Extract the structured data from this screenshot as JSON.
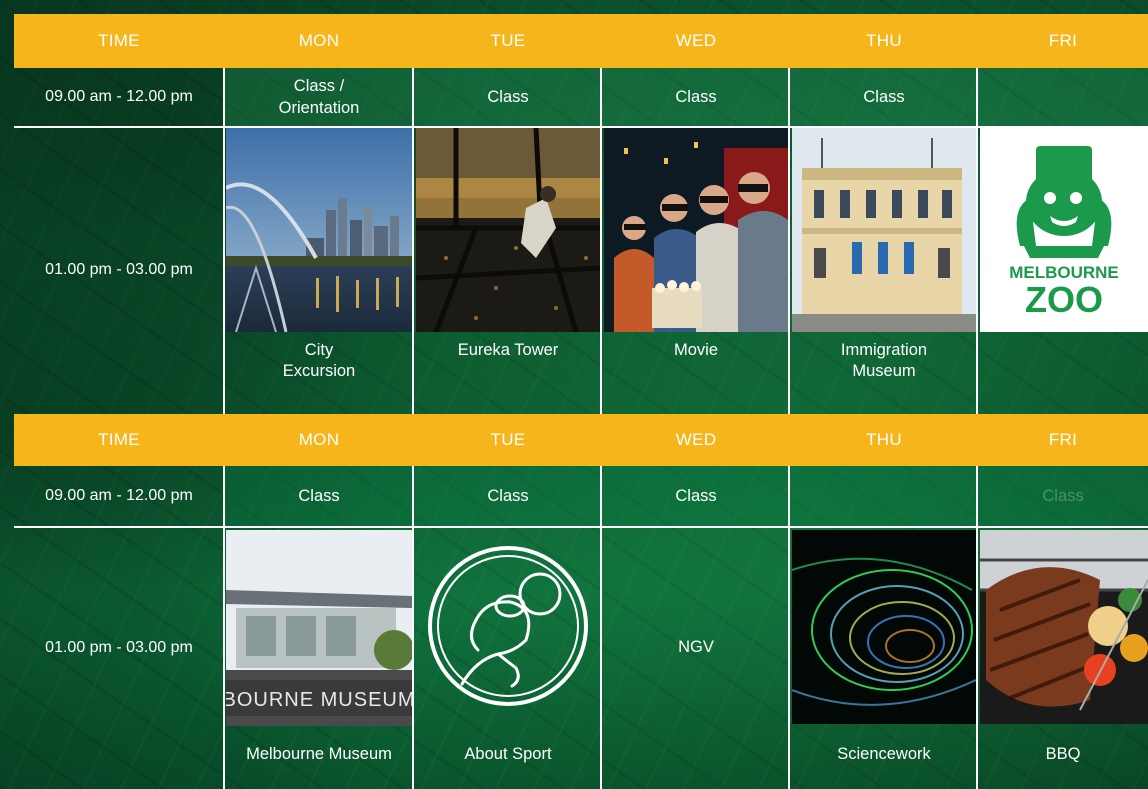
{
  "week1": {
    "header": [
      "TIME",
      "MON",
      "TUE",
      "WED",
      "THU",
      "FRI"
    ],
    "morning": {
      "time": "09.00 am - 12.00 pm",
      "mon": "Class /\nOrientation",
      "tue": "Class",
      "wed": "Class",
      "thu": "Class",
      "fri": ""
    },
    "afternoon": {
      "time": "01.00 pm - 03.00 pm",
      "mon": "City\nExcursion",
      "tue": "Eureka Tower",
      "wed": "Movie",
      "thu": "Immigration\nMuseum",
      "fri": "",
      "fri_logo_line1": "MELBOURNE",
      "fri_logo_line2": "ZOO"
    }
  },
  "week2": {
    "header": [
      "TIME",
      "MON",
      "TUE",
      "WED",
      "THU",
      "FRI"
    ],
    "morning": {
      "time": "09.00 am - 12.00 pm",
      "mon": "Class",
      "tue": "Class",
      "wed": "Class",
      "thu": "",
      "fri": "Class"
    },
    "afternoon": {
      "time": "01.00 pm - 03.00 pm",
      "mon": "Melbourne Museum",
      "mon_sign": "BOURNE MUSEUM",
      "tue": "About Sport",
      "wed": "NGV",
      "thu": "Sciencework",
      "fri": "BBQ"
    }
  },
  "colors": {
    "header_bar": "#f7b51c",
    "background": "#0c5a33",
    "zoo_green": "#1a9a4a"
  }
}
